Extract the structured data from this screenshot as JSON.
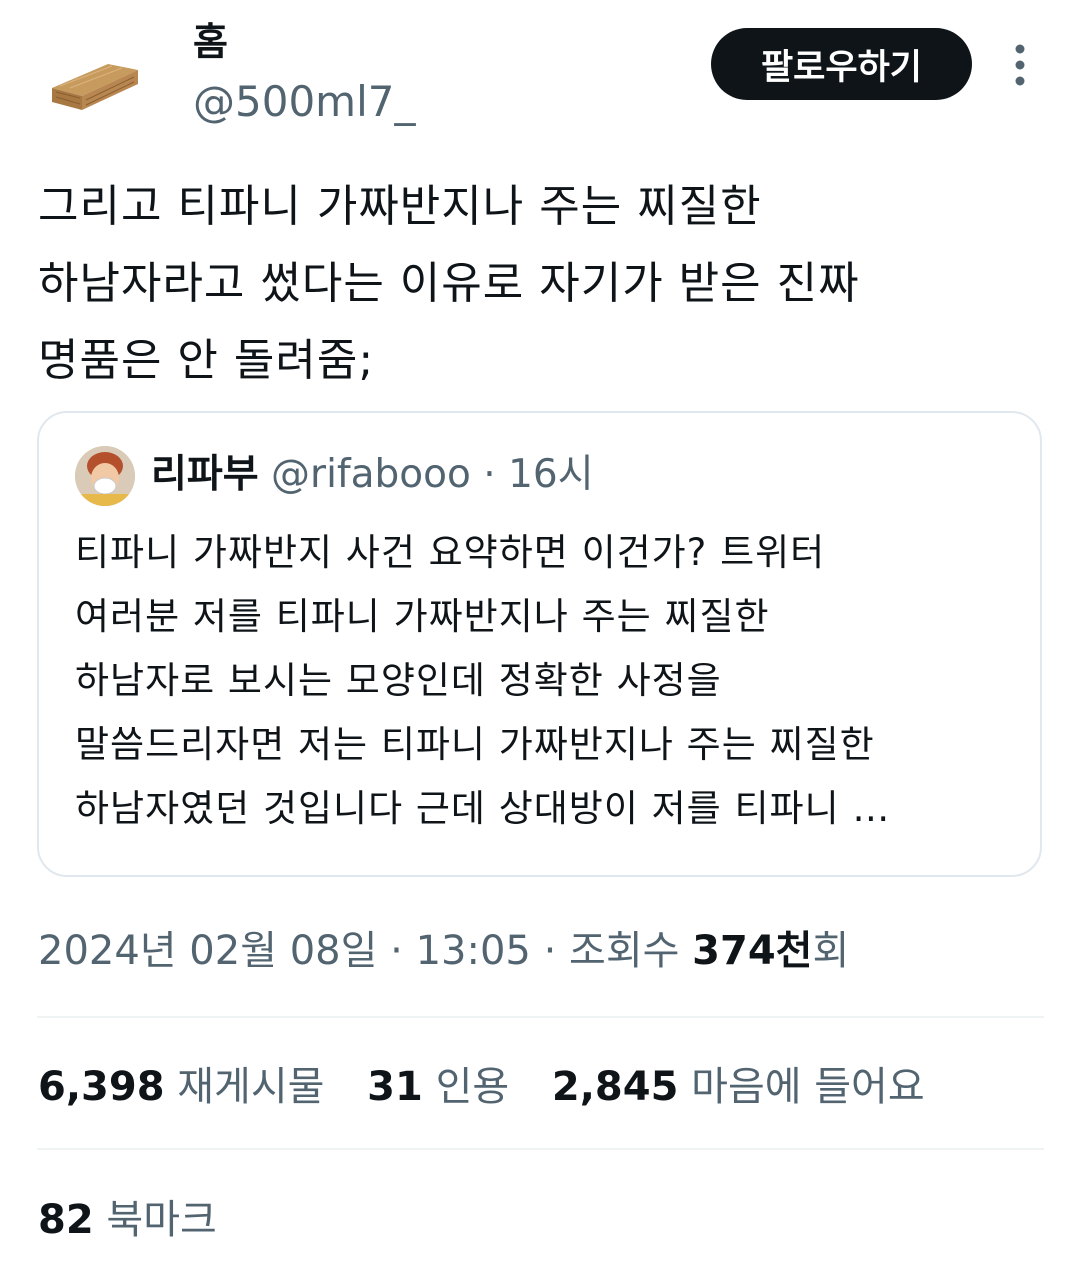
{
  "author": {
    "display_name": "홈",
    "handle": "@500ml7_",
    "avatar_icon": "wooden-coffin-avatar"
  },
  "follow_button_label": "팔로우하기",
  "more_icon": "more-vertical-icon",
  "tweet_text": "그리고 티파니 가짜반지나 주는 찌질한\n하남자라고 썼다는 이유로 자기가 받은 진짜\n명품은 안 돌려줌;",
  "quoted": {
    "name": "리파부",
    "handle": "@rifabooo",
    "separator": "·",
    "time": "16시",
    "text": "티파니 가짜반지 사건 요약하면 이건가? 트위터\n여러분 저를 티파니 가짜반지나 주는 찌질한\n하남자로 보시는 모양인데 정확한 사정을\n말씀드리자면 저는 티파니 가짜반지나 주는 찌질한\n하남자였던 것입니다 근데 상대방이 저를 티파니 …"
  },
  "meta": {
    "date": "2024년 02월 08일",
    "separator": "·",
    "time": "13:05",
    "views_label": "조회수",
    "views_count": "374천",
    "views_suffix": "회"
  },
  "stats": {
    "retweets": {
      "count": "6,398",
      "label": "재게시물"
    },
    "quotes": {
      "count": "31",
      "label": "인용"
    },
    "likes": {
      "count": "2,845",
      "label": "마음에 들어요"
    },
    "bookmarks": {
      "count": "82",
      "label": "북마크"
    }
  },
  "colors": {
    "text": "#0f1419",
    "secondary": "#536471",
    "border": "#e1e8ed",
    "button_bg": "#0f1419"
  }
}
